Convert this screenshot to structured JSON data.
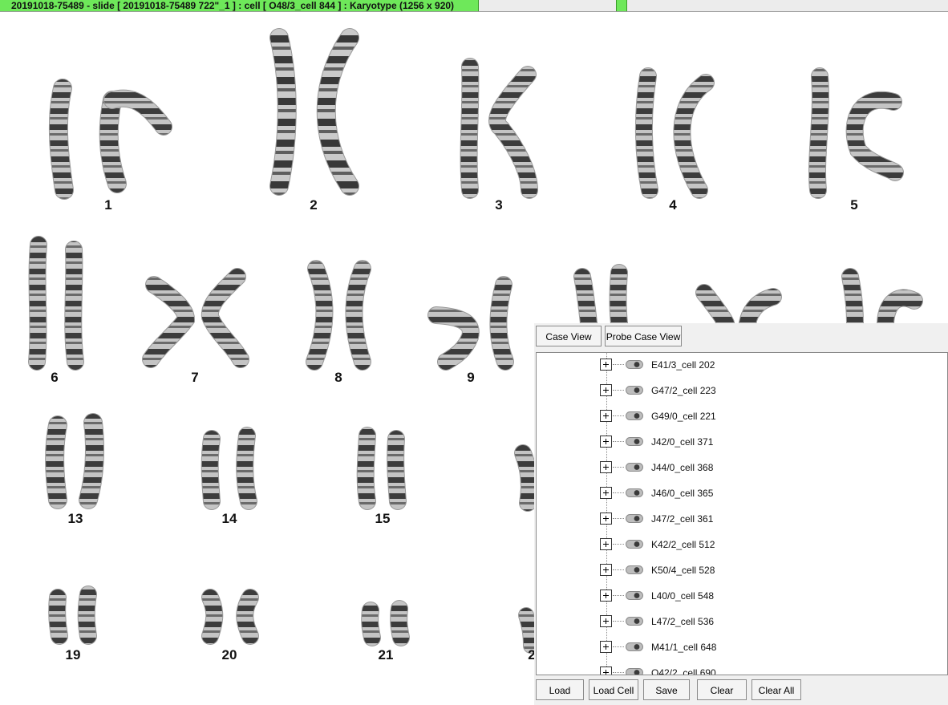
{
  "title_bar": {
    "text": "20191018-75489 - slide [ 20191018-75489 722\"_1 ] : cell [ O48/3_cell 844 ] : Karyotype  (1256 x 920)"
  },
  "karyogram": {
    "chromosome_labels": [
      "1",
      "2",
      "3",
      "4",
      "5",
      "6",
      "7",
      "8",
      "9",
      "13",
      "14",
      "15",
      "19",
      "20",
      "21",
      "2"
    ],
    "band_color": "#3a3a3a",
    "light_color": "#bdbdbd"
  },
  "panel": {
    "tabs": [
      "Case View",
      "Probe Case View"
    ],
    "tree_items": [
      "E41/3_cell 202",
      "G47/2_cell 223",
      "G49/0_cell 221",
      "J42/0_cell 371",
      "J44/0_cell 368",
      "J46/0_cell 365",
      "J47/2_cell 361",
      "K42/2_cell 512",
      "K50/4_cell 528",
      "L40/0_cell 548",
      "L47/2_cell 536",
      "M41/1_cell 648",
      "O42/2_cell 690"
    ],
    "buttons": [
      "Load",
      "Load Cell",
      "Save",
      "Clear",
      "Clear All"
    ]
  },
  "icons": {
    "expander": "plus-box-icon",
    "cell": "cell-capsule-icon"
  },
  "colors": {
    "title_green": "#6ee85a",
    "panel_bg": "#f0f0f0"
  }
}
